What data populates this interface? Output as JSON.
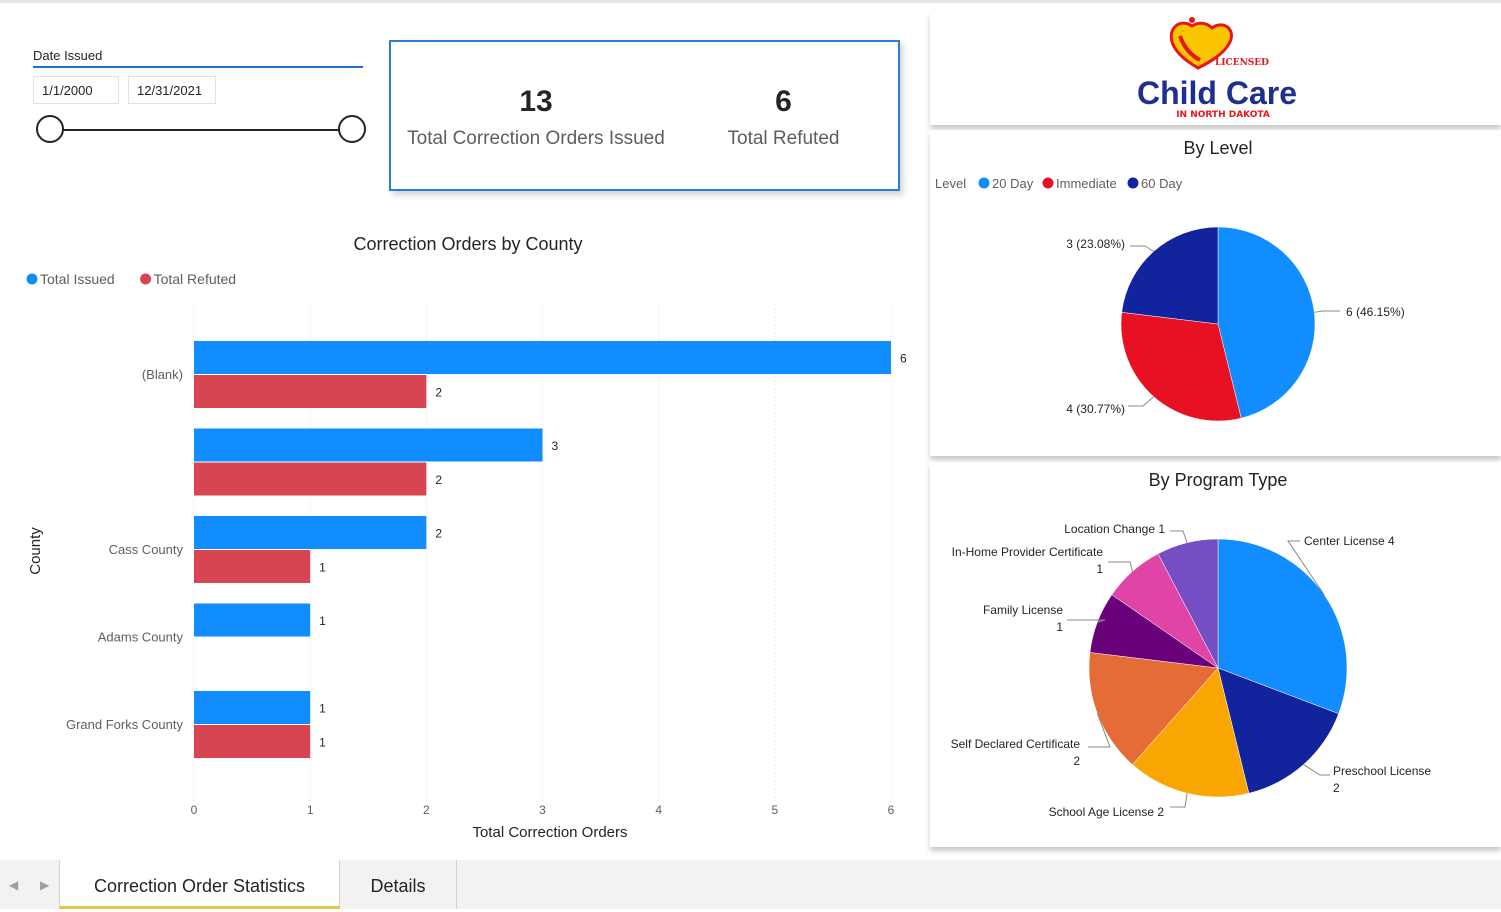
{
  "slicer": {
    "title": "Date Issued",
    "from": "1/1/2000",
    "to": "12/31/2021"
  },
  "kpis": [
    {
      "value": "13",
      "label": "Total Correction Orders Issued"
    },
    {
      "value": "6",
      "label": "Total Refuted"
    }
  ],
  "logo": {
    "top": "LICENSED",
    "main": "Child Care",
    "sub": "IN NORTH DAKOTA"
  },
  "tabs": [
    {
      "label": "Correction Order Statistics",
      "active": true
    },
    {
      "label": "Details",
      "active": false
    }
  ],
  "colors": {
    "accent": "#118DFF",
    "refuted": "#D64550",
    "immediate": "#E81123",
    "day60": "#12239E",
    "tab_underline": "#E8C53A"
  },
  "chart_data": [
    {
      "type": "bar",
      "orientation": "horizontal",
      "title": "Correction Orders by County",
      "xlabel": "Total Correction Orders",
      "ylabel": "County",
      "categories": [
        "(Blank)",
        "",
        "Cass County",
        "Adams County",
        "Grand Forks County"
      ],
      "series": [
        {
          "name": "Total Issued",
          "color": "#118DFF",
          "values": [
            6,
            3,
            2,
            1,
            1
          ]
        },
        {
          "name": "Total Refuted",
          "color": "#D64550",
          "values": [
            2,
            2,
            1,
            null,
            1
          ]
        }
      ],
      "xlim": [
        0,
        6
      ],
      "xticks": [
        "0",
        "1",
        "2",
        "3",
        "4",
        "5",
        "6"
      ],
      "legend": "top-left",
      "grid": true
    },
    {
      "type": "pie",
      "title": "By Level",
      "legend_title": "Level",
      "legend": "top-left",
      "slices": [
        {
          "name": "20 Day",
          "value": 6,
          "label": "6 (46.15%)",
          "color": "#118DFF"
        },
        {
          "name": "Immediate",
          "value": 4,
          "label": "4 (30.77%)",
          "color": "#E81123"
        },
        {
          "name": "60 Day",
          "value": 3,
          "label": "3 (23.08%)",
          "color": "#12239E"
        }
      ]
    },
    {
      "type": "pie",
      "title": "By Program Type",
      "slices": [
        {
          "name": "Center License",
          "value": 4,
          "label": [
            "Center License 4"
          ],
          "color": "#118DFF"
        },
        {
          "name": "Preschool License",
          "value": 2,
          "label": [
            "Preschool License",
            "2"
          ],
          "color": "#12239E"
        },
        {
          "name": "School Age License",
          "value": 2,
          "label": [
            "School Age License 2"
          ],
          "color": "#F9A602"
        },
        {
          "name": "Self Declared Certificate",
          "value": 2,
          "label": [
            "Self Declared Certificate",
            "2"
          ],
          "color": "#E66C37"
        },
        {
          "name": "Family License",
          "value": 1,
          "label": [
            "Family License",
            "1"
          ],
          "color": "#6B007B"
        },
        {
          "name": "In-Home Provider Certificate",
          "value": 1,
          "label": [
            "In-Home Provider Certificate",
            "1"
          ],
          "color": "#E044A7"
        },
        {
          "name": "Location Change",
          "value": 1,
          "label": [
            "Location Change 1"
          ],
          "color": "#744EC2"
        }
      ]
    }
  ]
}
